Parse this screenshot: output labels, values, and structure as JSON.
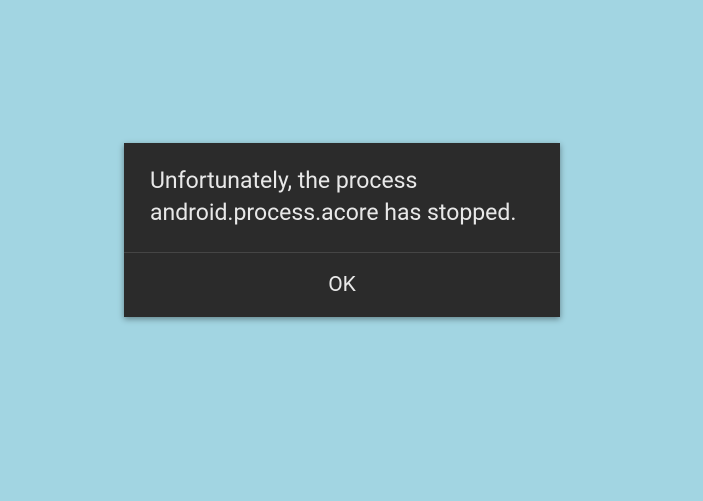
{
  "dialog": {
    "message": "Unfortunately, the process android.process.acore has stopped.",
    "ok_label": "OK"
  }
}
